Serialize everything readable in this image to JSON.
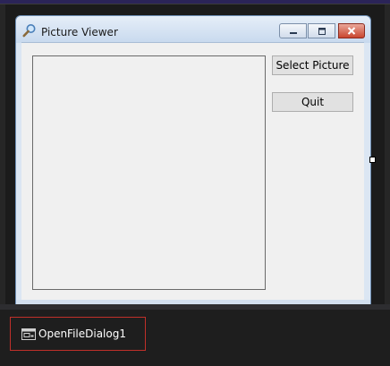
{
  "window": {
    "title": "Picture Viewer",
    "icon": "magnifier-icon"
  },
  "form": {
    "select_picture_label": "Select Picture",
    "quit_label": "Quit"
  },
  "component_tray": {
    "items": [
      {
        "label": "OpenFileDialog1",
        "icon": "dialog-component-icon"
      }
    ]
  },
  "colors": {
    "selection_border": "#c0302a",
    "designer_background": "#1e1e1e",
    "form_background": "#f0f0f0"
  }
}
